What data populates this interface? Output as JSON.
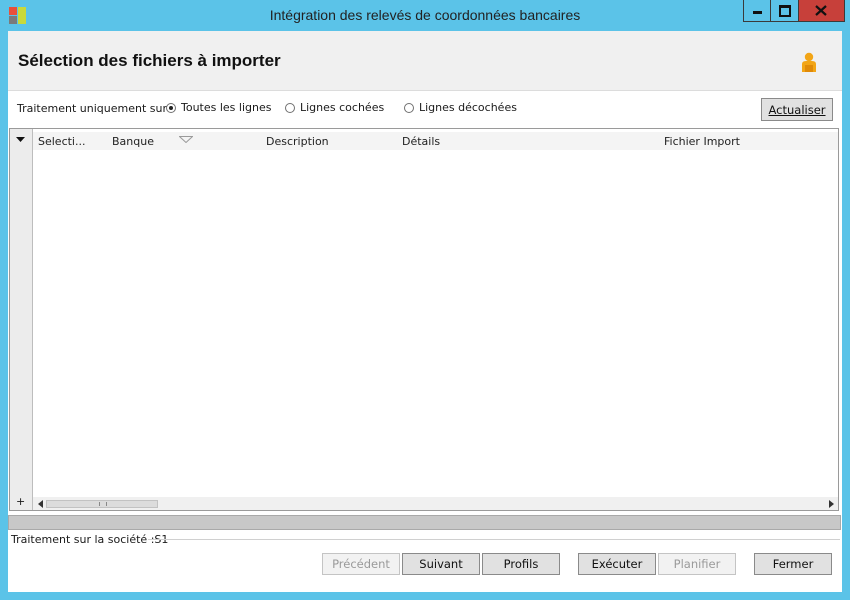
{
  "window": {
    "title": "Intégration des relevés de coordonnées bancaires",
    "minimize_label": "minimize",
    "maximize_label": "maximize",
    "close_label": "close"
  },
  "header": {
    "title": "Sélection des fichiers à importer",
    "icon": "user-icon"
  },
  "filter": {
    "label": "Traitement uniquement sur :",
    "options": [
      {
        "label": "Toutes les lignes",
        "selected": true
      },
      {
        "label": "Lignes cochées",
        "selected": false
      },
      {
        "label": "Lignes décochées",
        "selected": false
      }
    ],
    "refresh_label": "Actualiser"
  },
  "grid": {
    "columns": [
      "Selecti...",
      "Banque",
      "Description",
      "Détails",
      "Fichier Import"
    ],
    "add_symbol": "+",
    "rows": []
  },
  "status": {
    "text": "Traitement sur la société :S1"
  },
  "footer_buttons": {
    "previous": "Précédent",
    "next": "Suivant",
    "profiles": "Profils",
    "execute": "Exécuter",
    "schedule": "Planifier",
    "close": "Fermer"
  },
  "colors": {
    "title_bar": "#5bc3e8",
    "close_button": "#c7403a",
    "user_icon": "#f2a516"
  }
}
